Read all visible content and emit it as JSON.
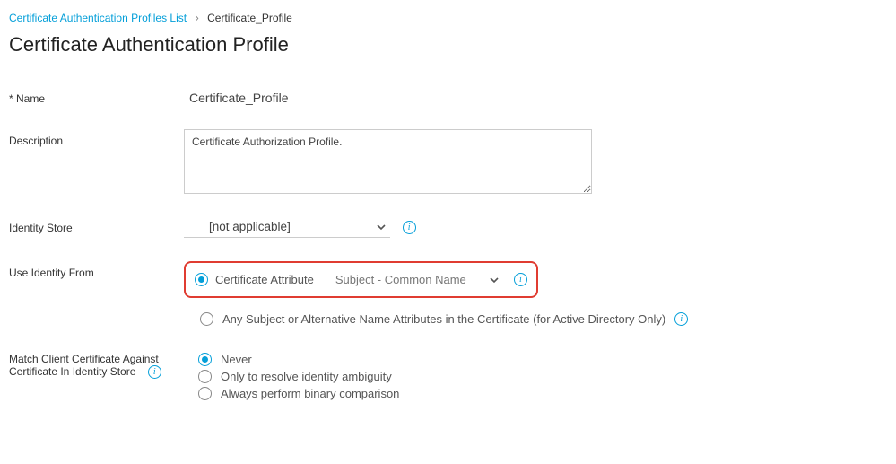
{
  "breadcrumb": {
    "list_link": "Certificate Authentication Profiles List",
    "current": "Certificate_Profile"
  },
  "page_title": "Certificate Authentication Profile",
  "labels": {
    "name": "Name",
    "description": "Description",
    "identity_store": "Identity Store",
    "use_identity_from": "Use Identity From",
    "match_client": "Match Client Certificate Against Certificate In Identity Store"
  },
  "fields": {
    "name_value": "Certificate_Profile",
    "description_value": "Certificate Authorization Profile.",
    "identity_store_value": "[not applicable]"
  },
  "identity_from": {
    "opt_cert_attr": "Certificate Attribute",
    "cert_attr_value": "Subject - Common Name",
    "opt_any_subject": "Any Subject or Alternative Name Attributes in the Certificate (for Active Directory Only)"
  },
  "match": {
    "opt_never": "Never",
    "opt_ambiguity": "Only to resolve identity ambiguity",
    "opt_binary": "Always perform binary comparison"
  }
}
